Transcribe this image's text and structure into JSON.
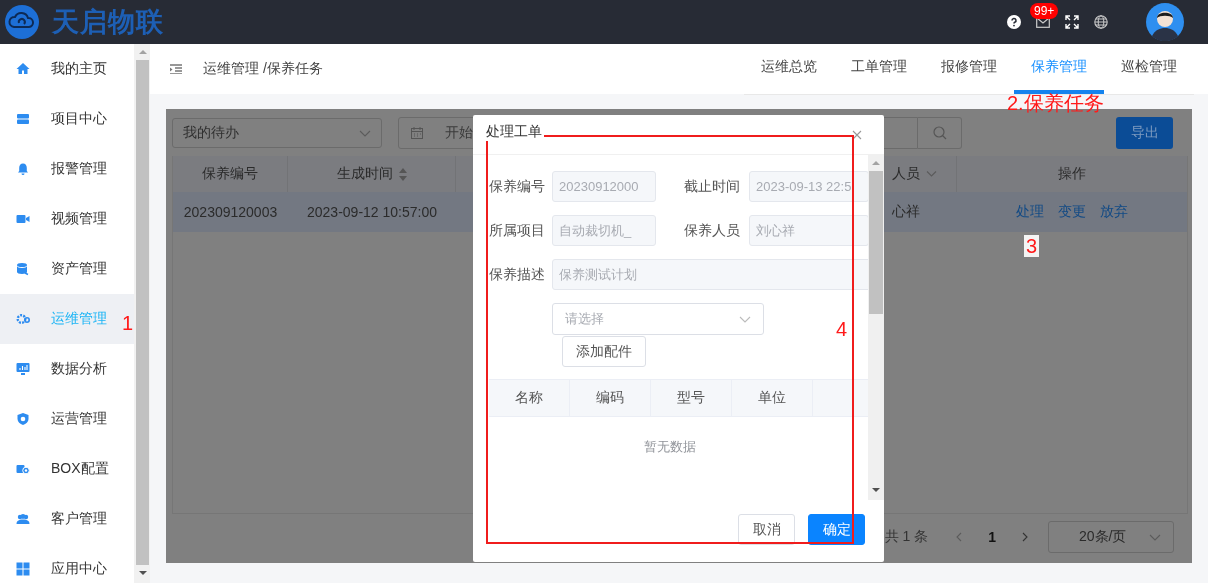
{
  "app": {
    "logo_text": "天启物联"
  },
  "header_icons": [
    {
      "kind": "help"
    },
    {
      "kind": "mail",
      "badge": "99+"
    },
    {
      "kind": "fullscreen"
    },
    {
      "kind": "globe"
    },
    {
      "kind": "avatar"
    }
  ],
  "sidebar": {
    "items": [
      {
        "label": "我的主页",
        "selected": false
      },
      {
        "label": "项目中心",
        "selected": false
      },
      {
        "label": "报警管理",
        "selected": false
      },
      {
        "label": "视频管理",
        "selected": false
      },
      {
        "label": "资产管理",
        "selected": false
      },
      {
        "label": "运维管理",
        "selected": true
      },
      {
        "label": "数据分析",
        "selected": false
      },
      {
        "label": "运营管理",
        "selected": false
      },
      {
        "label": "BOX配置",
        "selected": false
      },
      {
        "label": "客户管理",
        "selected": false
      },
      {
        "label": "应用中心",
        "selected": false
      }
    ]
  },
  "breadcrumb": "运维管理 /保养任务",
  "tabs": [
    {
      "label": "运维总览",
      "selected": false
    },
    {
      "label": "工单管理",
      "selected": false
    },
    {
      "label": "报修管理",
      "selected": false
    },
    {
      "label": "保养管理",
      "selected": true
    },
    {
      "label": "巡检管理",
      "selected": false
    }
  ],
  "filters": {
    "status_select": {
      "value": "我的待办"
    },
    "date_range": {
      "placeholder": "开始"
    }
  },
  "export_button": "导出",
  "table": {
    "columns": [
      {
        "label": "保养编号",
        "kind": "plain"
      },
      {
        "label": "生成时间",
        "kind": "sortable"
      },
      {
        "label": "人员",
        "kind": "filter"
      },
      {
        "label": "操作",
        "kind": "plain"
      }
    ],
    "rows": [
      {
        "cells": [
          "202309120003",
          "2023-09-12 10:57:00",
          "心祥"
        ],
        "actions": [
          "处理",
          "变更",
          "放弃"
        ]
      }
    ]
  },
  "pagination": {
    "total": "共 1 条",
    "pages": [
      {
        "label": "1",
        "selected": true
      }
    ],
    "page_size": "20条/页"
  },
  "modal": {
    "title": "处理工单",
    "fields": [
      {
        "label": "保养编号",
        "value": "20230912000",
        "kind": "half"
      },
      {
        "label": "截止时间",
        "value": "2023-09-13 22:5",
        "kind": "half"
      },
      {
        "label": "所属项目",
        "value": "自动裁切机_",
        "kind": "half"
      },
      {
        "label": "保养人员",
        "value": "刘心祥",
        "kind": "half"
      },
      {
        "label": "保养描述",
        "value": "保养测试计划",
        "kind": "full"
      }
    ],
    "part_select": {
      "placeholder": "请选择"
    },
    "add_button": "添加配件",
    "parts_table": {
      "columns": [
        "名称",
        "编码",
        "型号",
        "单位"
      ],
      "empty_text": "暂无数据"
    },
    "buttons": [
      {
        "label": "取消",
        "kind": "default"
      },
      {
        "label": "确定",
        "kind": "primary"
      }
    ]
  },
  "annotations": [
    {
      "kind": "label",
      "text": "1"
    },
    {
      "kind": "label",
      "text": "2.保养任务"
    },
    {
      "kind": "label",
      "text": "3"
    },
    {
      "kind": "label",
      "text": "4"
    },
    {
      "kind": "frame"
    }
  ]
}
